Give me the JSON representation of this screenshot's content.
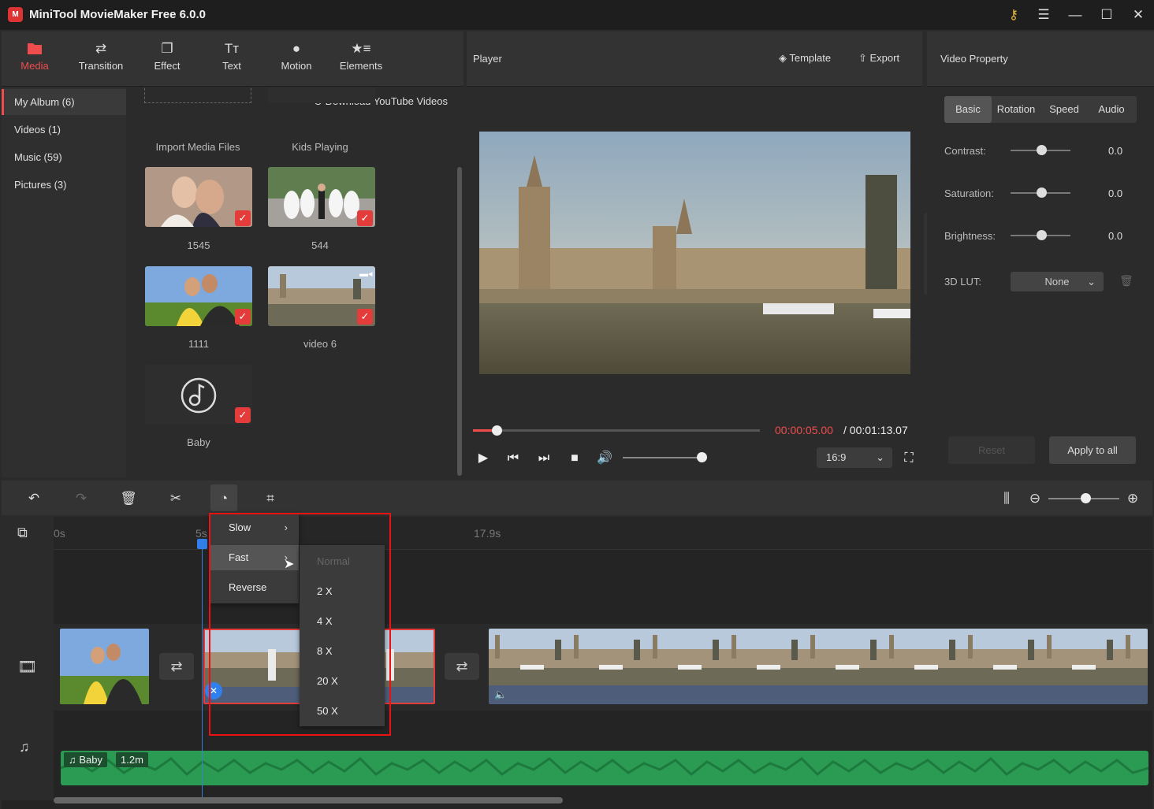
{
  "app": {
    "title": "MiniTool MovieMaker Free 6.0.0",
    "logo_text": "M"
  },
  "window_controls": {
    "key_icon": "key-icon",
    "menu_icon": "hamburger-icon",
    "minimize": "minimize-icon",
    "maximize": "maximize-icon",
    "close": "close-icon"
  },
  "media_tabs": [
    {
      "label": "Media",
      "icon": "folder-icon",
      "active": true
    },
    {
      "label": "Transition",
      "icon": "swap-icon"
    },
    {
      "label": "Effect",
      "icon": "effect-icon"
    },
    {
      "label": "Text",
      "icon": "text-icon"
    },
    {
      "label": "Motion",
      "icon": "motion-icon"
    },
    {
      "label": "Elements",
      "icon": "elements-icon"
    }
  ],
  "albums": [
    {
      "label": "My Album (6)",
      "active": true
    },
    {
      "label": "Videos (1)"
    },
    {
      "label": "Music (59)"
    },
    {
      "label": "Pictures (3)"
    }
  ],
  "media": {
    "download_youtube": "Download YouTube Videos",
    "items": [
      {
        "label": "Import Media Files"
      },
      {
        "label": "Kids Playing"
      },
      {
        "label": "1545",
        "checked": true
      },
      {
        "label": "544",
        "checked": true
      },
      {
        "label": "1111",
        "checked": true
      },
      {
        "label": "video 6",
        "checked": true
      },
      {
        "label": "Baby",
        "checked": true
      }
    ]
  },
  "player": {
    "title": "Player",
    "template_label": "Template",
    "export_label": "Export",
    "current_time": "00:00:05.00",
    "total_time": "/ 00:01:13.07",
    "aspect_ratio": "16:9",
    "progress": 0.082,
    "volume": 1.0
  },
  "property": {
    "title": "Video Property",
    "tabs": [
      "Basic",
      "Rotation",
      "Speed",
      "Audio"
    ],
    "active_tab": "Basic",
    "rows": [
      {
        "label": "Contrast:",
        "value": "0.0"
      },
      {
        "label": "Saturation:",
        "value": "0.0"
      },
      {
        "label": "Brightness:",
        "value": "0.0"
      }
    ],
    "lut_label": "3D LUT:",
    "lut_value": "None",
    "reset_label": "Reset",
    "apply_label": "Apply to all"
  },
  "timeline": {
    "ruler": [
      "0s",
      "5s",
      "17.9s"
    ],
    "audio_clip": {
      "name": "Baby",
      "duration": "1.2m"
    },
    "zoom": 0.45
  },
  "speed_menu": {
    "items": [
      {
        "label": "Slow",
        "has_sub": true
      },
      {
        "label": "Fast",
        "has_sub": true,
        "hover": true
      },
      {
        "label": "Reverse"
      }
    ]
  },
  "fast_submenu": {
    "items": [
      {
        "label": "Normal",
        "disabled": true
      },
      {
        "label": "2 X"
      },
      {
        "label": "4 X"
      },
      {
        "label": "8 X"
      },
      {
        "label": "20 X"
      },
      {
        "label": "50 X"
      }
    ]
  },
  "colors": {
    "accent": "#ef4d4d",
    "playhead": "#2f80ed",
    "audio_track": "#2b9a52",
    "highlight": "#ee1111"
  }
}
